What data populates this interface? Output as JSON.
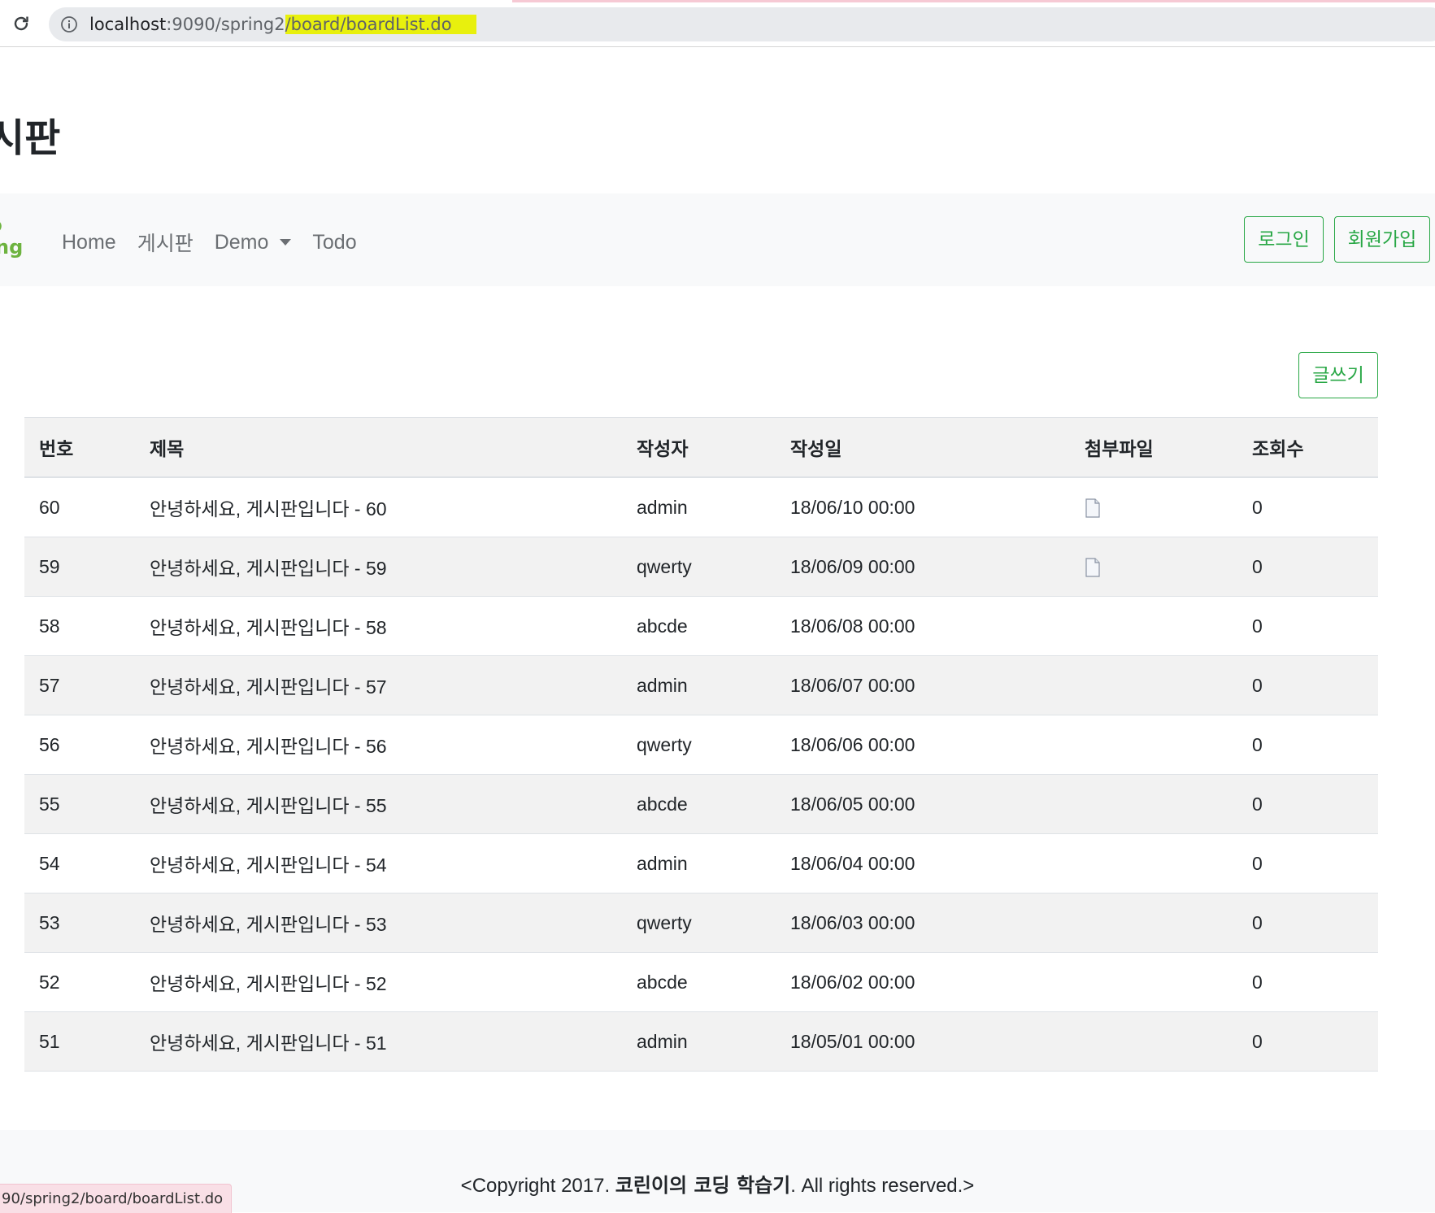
{
  "browser": {
    "url_host": "localhost",
    "url_port_path": ":9090/spring2",
    "url_highlighted": "/board/boardList.do",
    "status_url": "90/spring2/board/boardList.do"
  },
  "page": {
    "title": "시판"
  },
  "navbar": {
    "brand_text": "ng",
    "links": [
      {
        "label": "Home"
      },
      {
        "label": "게시판"
      },
      {
        "label": "Demo"
      },
      {
        "label": "Todo"
      }
    ],
    "login_label": "로그인",
    "join_label": "회원가입"
  },
  "board": {
    "write_label": "글쓰기",
    "headers": {
      "no": "번호",
      "title": "제목",
      "writer": "작성자",
      "date": "작성일",
      "file": "첨부파일",
      "count": "조회수"
    },
    "rows": [
      {
        "no": "60",
        "title": "안녕하세요, 게시판입니다 - 60",
        "writer": "admin",
        "date": "18/06/10 00:00",
        "has_file": true,
        "count": "0"
      },
      {
        "no": "59",
        "title": "안녕하세요, 게시판입니다 - 59",
        "writer": "qwerty",
        "date": "18/06/09 00:00",
        "has_file": true,
        "count": "0"
      },
      {
        "no": "58",
        "title": "안녕하세요, 게시판입니다 - 58",
        "writer": "abcde",
        "date": "18/06/08 00:00",
        "has_file": false,
        "count": "0"
      },
      {
        "no": "57",
        "title": "안녕하세요, 게시판입니다 - 57",
        "writer": "admin",
        "date": "18/06/07 00:00",
        "has_file": false,
        "count": "0"
      },
      {
        "no": "56",
        "title": "안녕하세요, 게시판입니다 - 56",
        "writer": "qwerty",
        "date": "18/06/06 00:00",
        "has_file": false,
        "count": "0"
      },
      {
        "no": "55",
        "title": "안녕하세요, 게시판입니다 - 55",
        "writer": "abcde",
        "date": "18/06/05 00:00",
        "has_file": false,
        "count": "0"
      },
      {
        "no": "54",
        "title": "안녕하세요, 게시판입니다 - 54",
        "writer": "admin",
        "date": "18/06/04 00:00",
        "has_file": false,
        "count": "0"
      },
      {
        "no": "53",
        "title": "안녕하세요, 게시판입니다 - 53",
        "writer": "qwerty",
        "date": "18/06/03 00:00",
        "has_file": false,
        "count": "0"
      },
      {
        "no": "52",
        "title": "안녕하세요, 게시판입니다 - 52",
        "writer": "abcde",
        "date": "18/06/02 00:00",
        "has_file": false,
        "count": "0"
      },
      {
        "no": "51",
        "title": "안녕하세요, 게시판입니다 - 51",
        "writer": "admin",
        "date": "18/05/01 00:00",
        "has_file": false,
        "count": "0"
      }
    ]
  },
  "footer": {
    "prefix": "<Copyright 2017. ",
    "bold": "코린이의 코딩 학습기",
    "suffix": ". All rights reserved.>"
  },
  "colors": {
    "accent_green": "#28a745",
    "url_highlight": "#e8f00d",
    "navbar_bg": "#f8f9fa",
    "striped_row": "#f2f2f2"
  },
  "icons": {
    "reload": "reload-icon",
    "info": "info-icon",
    "brand": "spring-leaf-icon",
    "attachment": "file-icon",
    "dropdown": "caret-down-icon"
  }
}
